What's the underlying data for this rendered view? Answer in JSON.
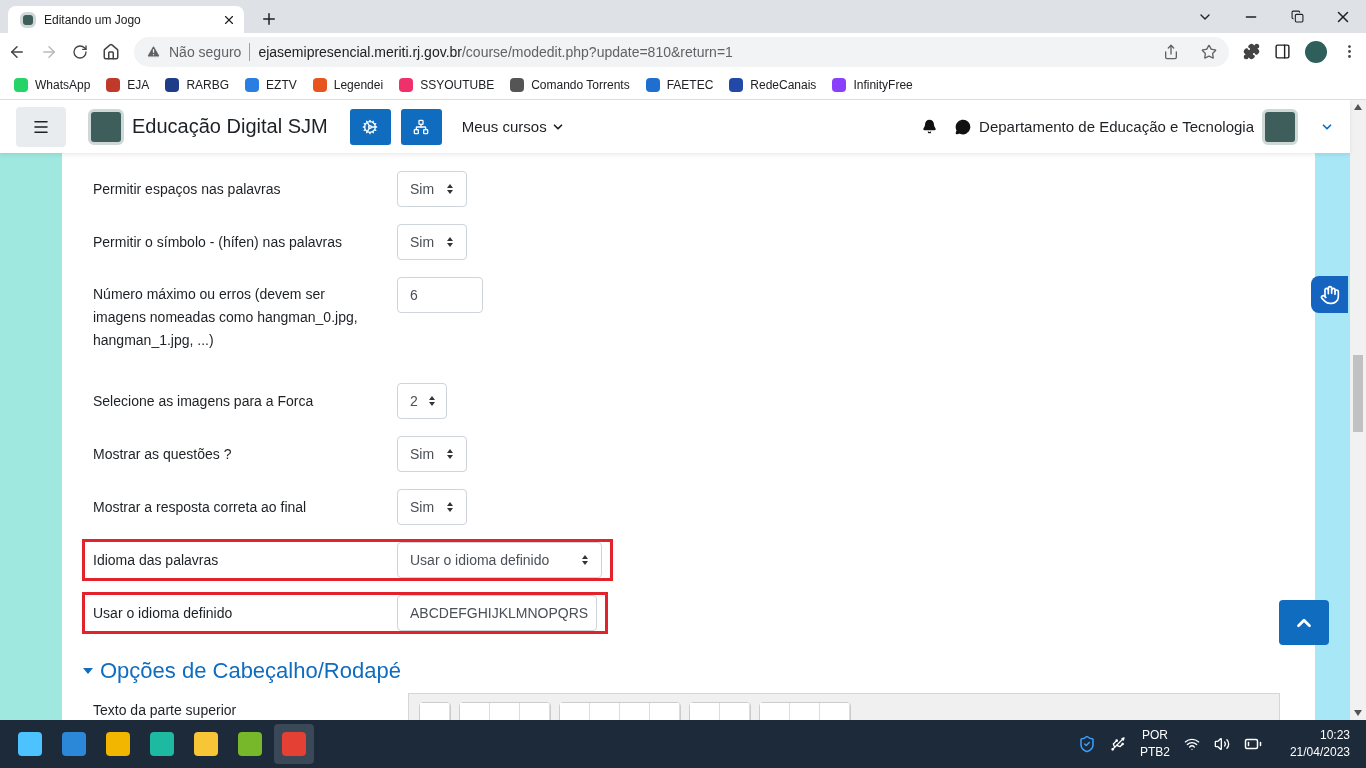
{
  "browser": {
    "tabs": [
      {
        "title": "Editando um Jogo",
        "selected": true
      }
    ],
    "address": {
      "security": "Não seguro",
      "host": "ejasemipresencial.meriti.rj.gov.br",
      "path": "/course/modedit.php?update=810&return=1"
    },
    "bookmarks": [
      {
        "label": "WhatsApp",
        "color": "#25d366"
      },
      {
        "label": "EJA",
        "color": "#c0392b"
      },
      {
        "label": "RARBG",
        "color": "#1f3c88"
      },
      {
        "label": "EZTV",
        "color": "#2a7de1"
      },
      {
        "label": "Legendei",
        "color": "#e8541e"
      },
      {
        "label": "SSYOUTUBE",
        "color": "#f0306a"
      },
      {
        "label": "Comando Torrents",
        "color": "#555555"
      },
      {
        "label": "FAETEC",
        "color": "#1e6fd0"
      },
      {
        "label": "RedeCanais",
        "color": "#2248a8"
      },
      {
        "label": "InfinityFree",
        "color": "#8a3ffc"
      }
    ]
  },
  "navbar": {
    "site_name": "Educação Digital SJM",
    "menu": "Meus cursos",
    "user": "Departamento de Educação e Tecnologia"
  },
  "form": {
    "rows": [
      {
        "label": "Permitir espaços nas palavras",
        "kind": "select",
        "value": "Sim",
        "highlighted": false
      },
      {
        "label": "Permitir o símbolo - (hífen) nas palavras",
        "kind": "select",
        "value": "Sim",
        "highlighted": false
      },
      {
        "label": "Número máximo ou erros (devem ser imagens nomeadas como hangman_0.jpg, hangman_1.jpg, ...)",
        "kind": "text",
        "value": "6",
        "highlighted": false
      },
      {
        "label": "Selecione as imagens para a Forca",
        "kind": "select",
        "value": "2",
        "highlighted": false
      },
      {
        "label": "Mostrar as questões ?",
        "kind": "select",
        "value": "Sim",
        "highlighted": false
      },
      {
        "label": "Mostrar a resposta correta ao final",
        "kind": "select",
        "value": "Sim",
        "highlighted": false
      },
      {
        "label": "Idioma das palavras",
        "kind": "wideselect",
        "value": "Usar o idioma definido",
        "highlighted": true
      },
      {
        "label": "Usar o idioma definido",
        "kind": "widetext",
        "value": "ABCDEFGHIJKLMNOPQRS",
        "highlighted": true
      }
    ]
  },
  "section": {
    "title": "Opções de Cabeçalho/Rodapé",
    "expanded": true,
    "field_label": "Texto da parte superior"
  },
  "taskbar": {
    "language": "POR",
    "layout": "PTB2",
    "time": "10:23",
    "date": "21/04/2023"
  }
}
